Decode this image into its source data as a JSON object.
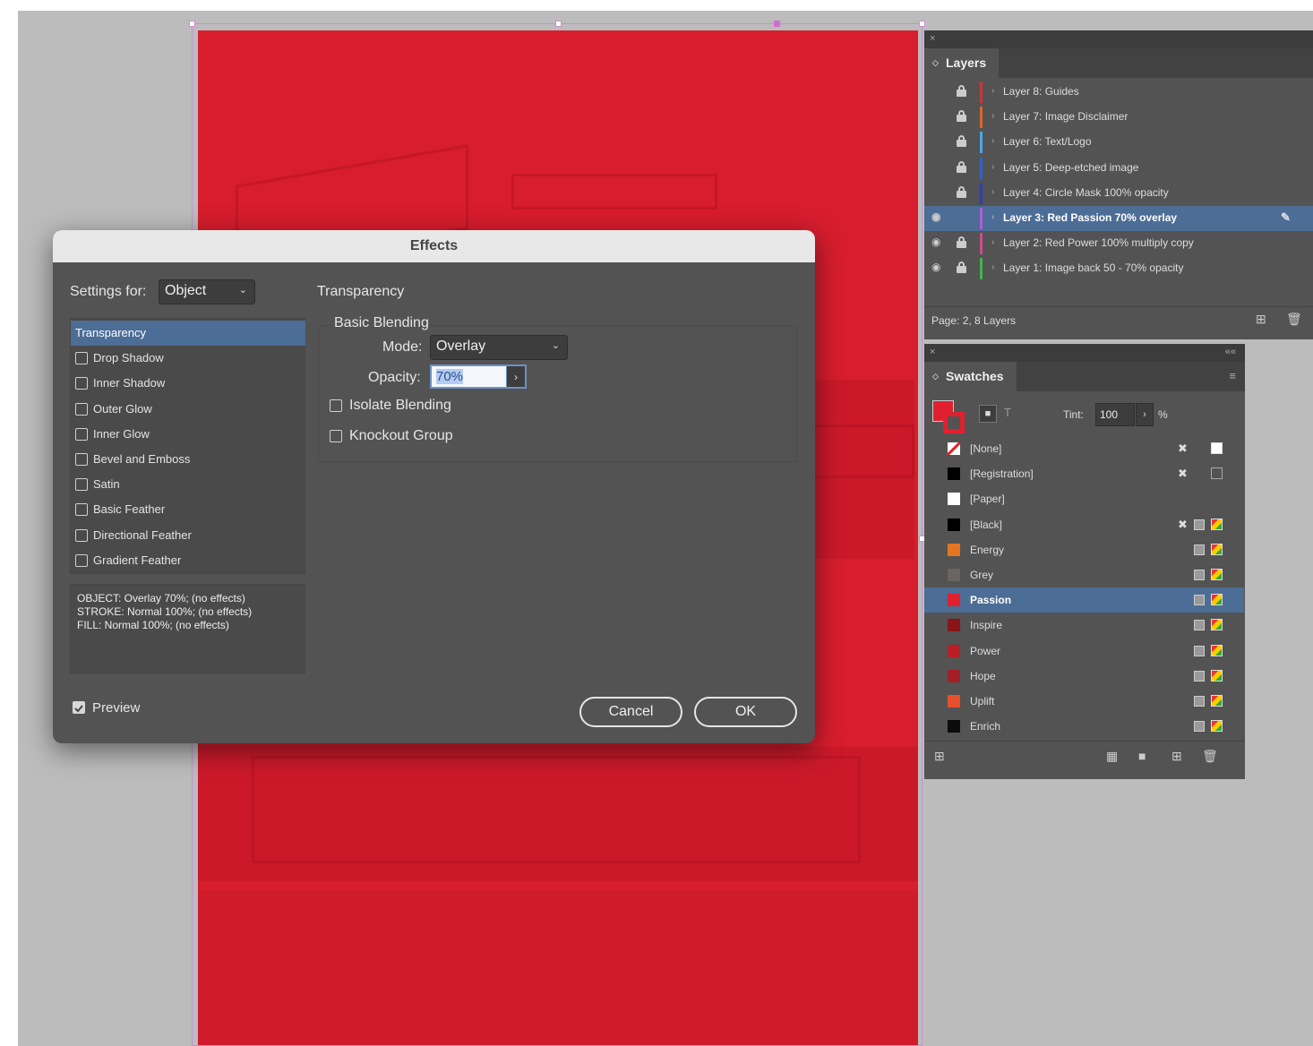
{
  "effects_dialog": {
    "title": "Effects",
    "settings_for_label": "Settings for:",
    "settings_for_value": "Object",
    "section_title": "Transparency",
    "group_title": "Basic Blending",
    "mode_label": "Mode:",
    "mode_value": "Overlay",
    "opacity_label": "Opacity:",
    "opacity_value": "70%",
    "isolate_blending_label": "Isolate Blending",
    "knockout_group_label": "Knockout Group",
    "effects_list": [
      {
        "label": "Transparency",
        "selected": true
      },
      {
        "label": "Drop Shadow",
        "checked": false
      },
      {
        "label": "Inner Shadow",
        "checked": false
      },
      {
        "label": "Outer Glow",
        "checked": false
      },
      {
        "label": "Inner Glow",
        "checked": false
      },
      {
        "label": "Bevel and Emboss",
        "checked": false
      },
      {
        "label": "Satin",
        "checked": false
      },
      {
        "label": "Basic Feather",
        "checked": false
      },
      {
        "label": "Directional Feather",
        "checked": false
      },
      {
        "label": "Gradient Feather",
        "checked": false
      }
    ],
    "summary": [
      "OBJECT: Overlay 70%; (no effects)",
      "STROKE: Normal 100%; (no effects)",
      "FILL: Normal 100%; (no effects)"
    ],
    "preview_label": "Preview",
    "preview_checked": true,
    "cancel_label": "Cancel",
    "ok_label": "OK"
  },
  "layers_panel": {
    "close_glyph": "×",
    "tab_label": "Layers",
    "layers": [
      {
        "name": "Layer 8: Guides",
        "color": "#c8373a",
        "visible": false,
        "locked": true
      },
      {
        "name": "Layer 7: Image Disclaimer",
        "color": "#e0632a",
        "visible": false,
        "locked": true
      },
      {
        "name": "Layer 6: Text/Logo",
        "color": "#4aa7e6",
        "visible": false,
        "locked": true
      },
      {
        "name": "Layer 5: Deep-etched image",
        "color": "#2f63c9",
        "visible": false,
        "locked": true
      },
      {
        "name": "Layer 4: Circle Mask 100% opacity",
        "color": "#2f3fa8",
        "visible": false,
        "locked": true
      },
      {
        "name": "Layer 3: Red Passion 70% overlay",
        "color": "#b25cd6",
        "visible": true,
        "locked": false,
        "selected": true
      },
      {
        "name": "Layer 2: Red Power 100% multiply copy",
        "color": "#d14a8c",
        "visible": true,
        "locked": true
      },
      {
        "name": "Layer 1: Image back 50 - 70% opacity",
        "color": "#3fb54a",
        "visible": true,
        "locked": true
      }
    ],
    "footer_text": "Page: 2, 8 Layers"
  },
  "swatches_panel": {
    "close_glyph": "×",
    "collapse_glyph": "««",
    "tab_label": "Swatches",
    "fill_color": "#e0202f",
    "tint_label": "Tint:",
    "tint_value": "100",
    "tint_unit": "%",
    "swatches": [
      {
        "name": "[None]",
        "chip": "none",
        "icons": "nonedit-white"
      },
      {
        "name": "[Registration]",
        "chip": "#000000",
        "icons": "nonedit-reg"
      },
      {
        "name": "[Paper]",
        "chip": "#ffffff",
        "icons": ""
      },
      {
        "name": "[Black]",
        "chip": "#000000",
        "icons": "nonedit-process"
      },
      {
        "name": "Energy",
        "chip": "#e5761f",
        "icons": "process"
      },
      {
        "name": "Grey",
        "chip": "#6a6560",
        "icons": "process"
      },
      {
        "name": "Passion",
        "chip": "#e0202f",
        "icons": "process",
        "selected": true
      },
      {
        "name": "Inspire",
        "chip": "#8a1418",
        "icons": "process"
      },
      {
        "name": "Power",
        "chip": "#b81e24",
        "icons": "process"
      },
      {
        "name": "Hope",
        "chip": "#a31f26",
        "icons": "process"
      },
      {
        "name": "Uplift",
        "chip": "#e84e2c",
        "icons": "process"
      },
      {
        "name": "Enrich",
        "chip": "#0b0b0b",
        "icons": "process"
      }
    ]
  },
  "icons": {
    "eye": "eye-icon",
    "lock": "lock-icon",
    "pen": "pen-icon",
    "new_layer": "new-layer-icon",
    "trash": "trash-icon",
    "folder": "folder-icon",
    "grid": "swatch-view-icon"
  }
}
